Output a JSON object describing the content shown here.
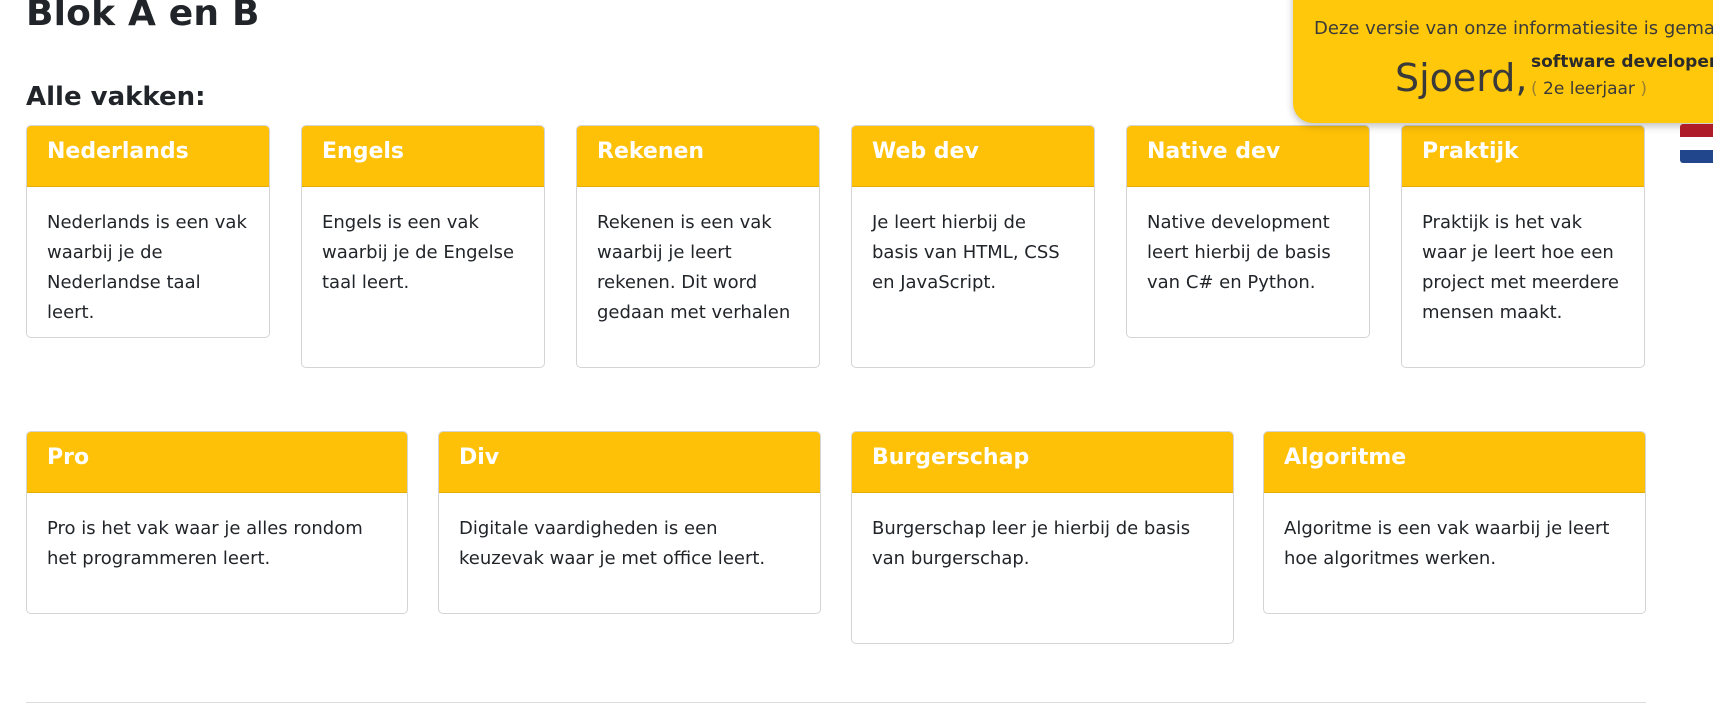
{
  "page": {
    "title": "Blok A en B",
    "subtitle": "Alle vakken:"
  },
  "banner": {
    "text": "Deze versie van onze informatiesite is gemaakt door",
    "name": "Sjoerd,",
    "role": "software developer",
    "year_open": "(",
    "year": "2e leerjaar",
    "year_close": ")",
    "flag_icon": "netherlands-flag-icon"
  },
  "colors": {
    "accent": "#ffc107",
    "card_header_text": "#ffffff",
    "banner_bg": "#ffc80a"
  },
  "cards_row1": [
    {
      "title": "Nederlands",
      "text": "Nederlands is een vak waarbij je de Nederlandse taal leert."
    },
    {
      "title": "Engels",
      "text": "Engels is een vak waarbij je de Engelse taal leert."
    },
    {
      "title": "Rekenen",
      "text": "Rekenen is een vak waarbij je leert rekenen. Dit word gedaan met verhalen"
    },
    {
      "title": "Web dev",
      "text": "Je leert hierbij de basis van HTML, CSS en JavaScript."
    },
    {
      "title": "Native dev",
      "text": "Native development leert hierbij de basis van C# en Python."
    },
    {
      "title": "Praktijk",
      "text": "Praktijk is het vak waar je leert hoe een project met meerdere mensen maakt."
    }
  ],
  "cards_row2": [
    {
      "title": "Pro",
      "text": "Pro is het vak waar je alles rondom het programmeren leert."
    },
    {
      "title": "Div",
      "text": "Digitale vaardigheden is een keuzevak waar je met office leert."
    },
    {
      "title": "Burgerschap",
      "text": "Burgerschap leer je hierbij de basis van burgerschap."
    },
    {
      "title": "Algoritme",
      "text": "Algoritme is een vak waarbij je leert hoe algoritmes werken."
    }
  ]
}
